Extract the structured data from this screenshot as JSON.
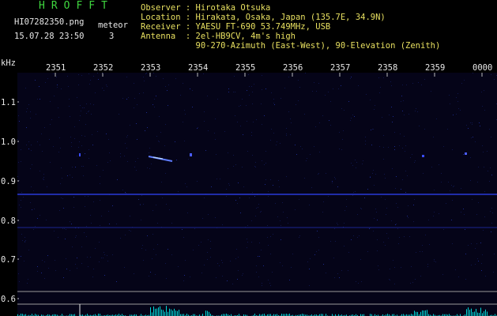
{
  "header": {
    "title": "HROFFT",
    "filename": "HI07282350.png",
    "datetime": "15.07.28 23:50",
    "meteor_label": "meteor",
    "meteor_count": "3"
  },
  "station": {
    "observer": "Observer : Hirotaka Otsuka",
    "location": "Location : Hirakata, Osaka, Japan (135.7E, 34.9N)",
    "receiver": "Receiver : YAESU FT-690 53.749MHz, USB",
    "antenna": "Antenna  : 2el-HB9CV, 4m's high",
    "antenna2": "           90-270-Azimuth (East-West), 90-Elevation (Zenith)"
  },
  "axis": {
    "unit": "kHz",
    "time_ticks": [
      "2351",
      "2352",
      "2353",
      "2354",
      "2355",
      "2356",
      "2357",
      "2358",
      "2359",
      "0000"
    ],
    "freq_ticks": [
      "1.1",
      "1.0",
      "0.9",
      "0.8",
      "0.7",
      "0.6"
    ]
  },
  "colors": {
    "background": "#000000",
    "plot_bg": "#050418",
    "header_text": "#3fd63f",
    "info_text": "#e8e060",
    "signal": "#3a4cff",
    "echo": "#9fc8ff",
    "spectrum": "#00e0e0"
  }
}
